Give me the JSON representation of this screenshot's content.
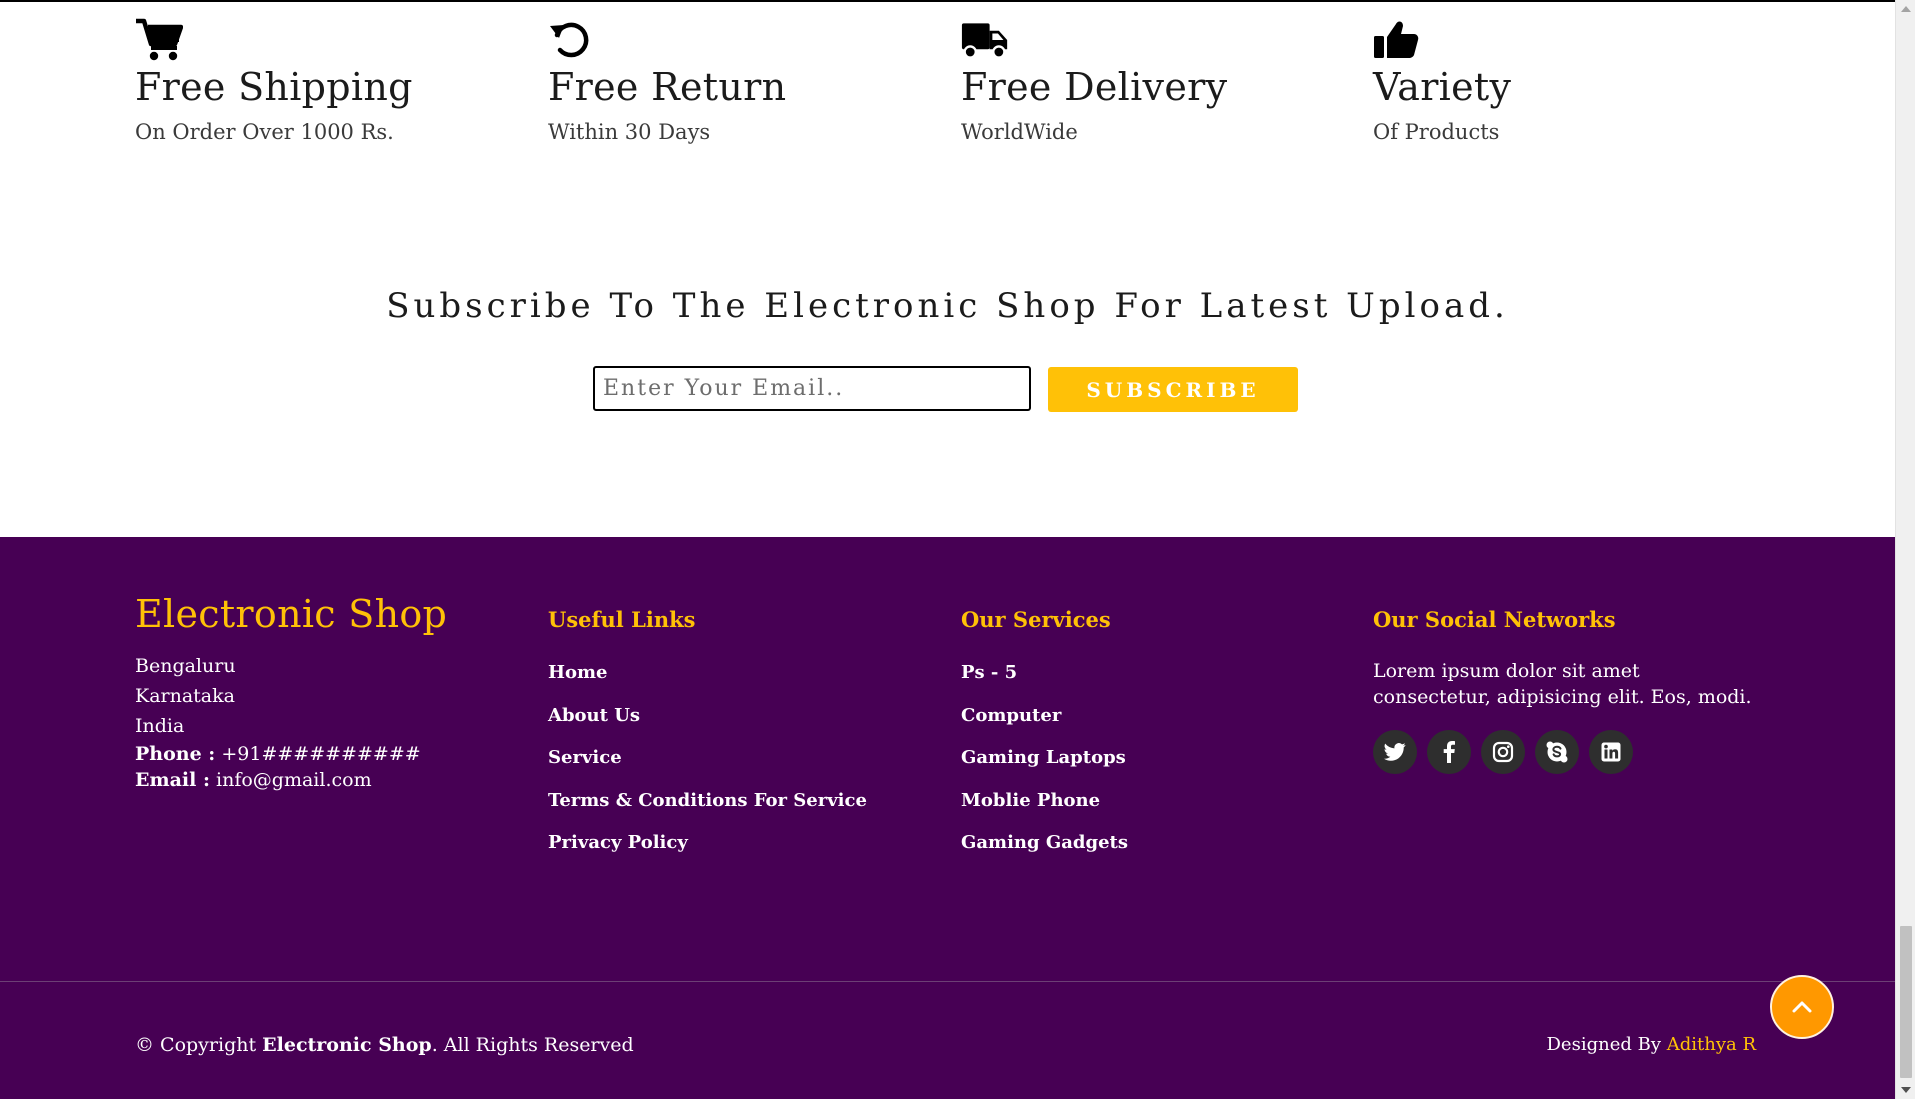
{
  "features": [
    {
      "icon": "cart-icon",
      "title": "Free Shipping",
      "subtitle": "On Order Over 1000 Rs."
    },
    {
      "icon": "return-icon",
      "title": "Free Return",
      "subtitle": "Within 30 Days"
    },
    {
      "icon": "truck-icon",
      "title": "Free Delivery",
      "subtitle": "WorldWide"
    },
    {
      "icon": "thumbs-up-icon",
      "title": "Variety",
      "subtitle": "Of Products"
    }
  ],
  "subscribe": {
    "heading": "Subscribe To The Electronic Shop For Latest Upload.",
    "email_placeholder": "Enter Your Email..",
    "email_value": "",
    "button_label": "SUBSCRIBE"
  },
  "footer": {
    "brand": "Electronic Shop",
    "address": [
      "Bengaluru",
      "Karnataka",
      "India"
    ],
    "phone_label": "Phone :",
    "phone_value": "+91##########",
    "email_label": "Email :",
    "email_value": "info@gmail.com",
    "useful_links": {
      "title": "Useful Links",
      "items": [
        "Home",
        "About Us",
        "Service",
        "Terms & Conditions For Service",
        "Privacy Policy"
      ]
    },
    "services": {
      "title": "Our Services",
      "items": [
        "Ps - 5",
        "Computer",
        "Gaming Laptops",
        "Moblie Phone",
        "Gaming Gadgets"
      ]
    },
    "social": {
      "title": "Our Social Networks",
      "text": "Lorem ipsum dolor sit amet consectetur, adipisicing elit. Eos, modi.",
      "icons": [
        "twitter-icon",
        "facebook-icon",
        "instagram-icon",
        "skype-icon",
        "linkedin-icon"
      ]
    },
    "copyright_prefix": "© Copyright ",
    "copyright_brand": "Electronic Shop",
    "copyright_suffix": ". All Rights Reserved",
    "designed_by_label": "Designed By ",
    "designer_name": "Adithya R"
  },
  "colors": {
    "footer_bg": "#470054",
    "accent": "#ffc107",
    "back_to_top": "#ff9800",
    "social_btn": "#2e2e2e"
  }
}
